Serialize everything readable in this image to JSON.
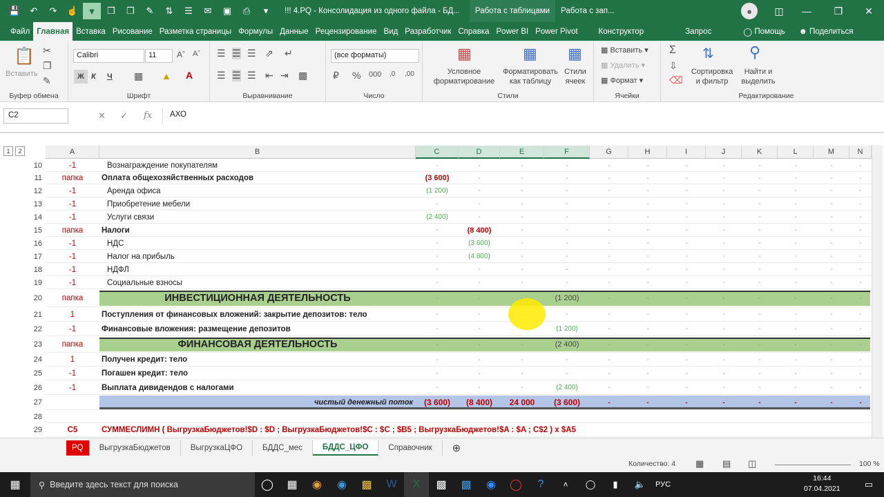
{
  "title_bar": {
    "doc_title": "!!! 4.PQ - Консолидация из одного файла - БД...",
    "context_tab1": "Работа с таблицами",
    "context_tab2": "Работа с зап..."
  },
  "menu": {
    "tabs": [
      "Файл",
      "Главная",
      "Вставка",
      "Рисование",
      "Разметка страницы",
      "Формулы",
      "Данные",
      "Рецензирование",
      "Вид",
      "Разработчик",
      "Справка",
      "Power BI",
      "Power Pivot",
      "Конструктор",
      "Запрос"
    ],
    "help": "Помощь",
    "share": "Поделиться"
  },
  "ribbon": {
    "clipboard": {
      "paste": "Вставить",
      "label": "Буфер обмена"
    },
    "font": {
      "name": "Calibri",
      "size": "11",
      "label": "Шрифт",
      "bold": "Ж",
      "italic": "К",
      "underline": "Ч"
    },
    "alignment": {
      "label": "Выравнивание"
    },
    "number": {
      "format": "(все форматы)",
      "label": "Число"
    },
    "styles": {
      "cond_format": "Условное форматирование",
      "format_table": "Форматировать как таблицу",
      "cell_styles": "Стили ячеек",
      "label": "Стили"
    },
    "cells": {
      "insert": "Вставить",
      "delete": "Удалить",
      "format": "Формат",
      "label": "Ячейки"
    },
    "editing": {
      "sort": "Сортировка и фильтр",
      "find": "Найти и выделить",
      "label": "Редактирование"
    }
  },
  "formula_bar": {
    "name_box": "C2",
    "fx": "fx",
    "value": "АХО"
  },
  "columns": [
    "A",
    "B",
    "C",
    "D",
    "E",
    "F",
    "G",
    "H",
    "I",
    "J",
    "K",
    "L",
    "M",
    "N"
  ],
  "outline_levels": [
    "1",
    "2"
  ],
  "rows": [
    {
      "n": "10",
      "a": "-1",
      "b": "Вознаграждение покупателям",
      "bold": false,
      "indent": true,
      "vals": [
        "-",
        "-",
        "-",
        "-"
      ]
    },
    {
      "n": "11",
      "a": "папка",
      "b": "Оплата общехозяйственных расходов",
      "bold": true,
      "indent": false,
      "vals": [
        "(3 600)",
        "-",
        "-",
        "-"
      ]
    },
    {
      "n": "12",
      "a": "-1",
      "b": "Аренда офиса",
      "bold": false,
      "indent": true,
      "vals": [
        "(1 200)",
        "-",
        "-",
        "-"
      ]
    },
    {
      "n": "13",
      "a": "-1",
      "b": "Приобретение мебели",
      "bold": false,
      "indent": true,
      "vals": [
        "-",
        "-",
        "-",
        "-"
      ]
    },
    {
      "n": "14",
      "a": "-1",
      "b": "Услуги связи",
      "bold": false,
      "indent": true,
      "vals": [
        "(2 400)",
        "-",
        "-",
        "-"
      ]
    },
    {
      "n": "15",
      "a": "папка",
      "b": "Налоги",
      "bold": true,
      "indent": false,
      "vals": [
        "-",
        "(8 400)",
        "-",
        "-"
      ]
    },
    {
      "n": "16",
      "a": "-1",
      "b": "НДС",
      "bold": false,
      "indent": true,
      "vals": [
        "-",
        "(3 600)",
        "-",
        "-"
      ]
    },
    {
      "n": "17",
      "a": "-1",
      "b": "Налог на прибыль",
      "bold": false,
      "indent": true,
      "vals": [
        "-",
        "(4 800)",
        "-",
        "-"
      ]
    },
    {
      "n": "18",
      "a": "-1",
      "b": "НДФЛ",
      "bold": false,
      "indent": true,
      "vals": [
        "-",
        "-",
        "-",
        "-"
      ]
    },
    {
      "n": "19",
      "a": "-1",
      "b": "Социальные взносы",
      "bold": false,
      "indent": true,
      "vals": [
        "-",
        "-",
        "-",
        "-"
      ]
    },
    {
      "n": "20",
      "a": "папка",
      "b": "ИНВЕСТИЦИОННАЯ ДЕЯТЕЛЬНОСТЬ",
      "bold": true,
      "indent": false,
      "vals": [
        "-",
        "-",
        "-",
        "(1 200)"
      ]
    },
    {
      "n": "21",
      "a": "1",
      "b": "Поступления от финансовых вложений: закрытие депозитов: тело",
      "bold": true,
      "indent": false,
      "vals": [
        "-",
        "-",
        "-",
        "-"
      ]
    },
    {
      "n": "22",
      "a": "-1",
      "b": "Финансовые вложения: размещение депозитов",
      "bold": true,
      "indent": false,
      "vals": [
        "-",
        "-",
        "-",
        "(1 200)"
      ]
    },
    {
      "n": "23",
      "a": "папка",
      "b": "ФИНАНСОВАЯ ДЕЯТЕЛЬНОСТЬ",
      "bold": true,
      "indent": false,
      "vals": [
        "-",
        "-",
        "-",
        "(2 400)"
      ]
    },
    {
      "n": "24",
      "a": "1",
      "b": "Получен кредит: тело",
      "bold": true,
      "indent": false,
      "vals": [
        "-",
        "-",
        "-",
        "-"
      ]
    },
    {
      "n": "25",
      "a": "-1",
      "b": "Погашен кредит: тело",
      "bold": true,
      "indent": false,
      "vals": [
        "-",
        "-",
        "-",
        "-"
      ]
    },
    {
      "n": "26",
      "a": "-1",
      "b": "Выплата дивидендов с налогами",
      "bold": true,
      "indent": false,
      "vals": [
        "-",
        "-",
        "-",
        "(2 400)"
      ]
    },
    {
      "n": "27",
      "a": "",
      "b": "чистый денежный поток",
      "bold": true,
      "indent": false,
      "vals": [
        "(3 600)",
        "(8 400)",
        "24 000",
        "(3 600)"
      ]
    },
    {
      "n": "28",
      "a": "",
      "b": "",
      "bold": false,
      "indent": false,
      "vals": [
        "",
        "",
        "",
        ""
      ]
    },
    {
      "n": "29",
      "a": "C5",
      "b": "СУММЕСЛИМН ( ВыгрузкаБюджетов!$D : $D ; ВыгрузкаБюджетов!$C : $C ; $B5 ; ВыгрузкаБюджетов!$A : $A ; C$2 ) x $A5",
      "bold": true,
      "indent": false,
      "vals": [
        "",
        "",
        "",
        ""
      ]
    }
  ],
  "sheet_tabs": [
    "PQ",
    "ВыгрузкаБюджетов",
    "ВыгрузкаЦФО",
    "БДДС_мес",
    "БДДС_ЦФО",
    "Справочник"
  ],
  "active_tab": "БДДС_ЦФО",
  "status": {
    "count_label": "Количество: 4",
    "zoom": "100 %"
  },
  "taskbar": {
    "search_placeholder": "Введите здесь текст для поиска",
    "lang": "РУС",
    "time": "16:44",
    "date": "07.04.2021"
  }
}
